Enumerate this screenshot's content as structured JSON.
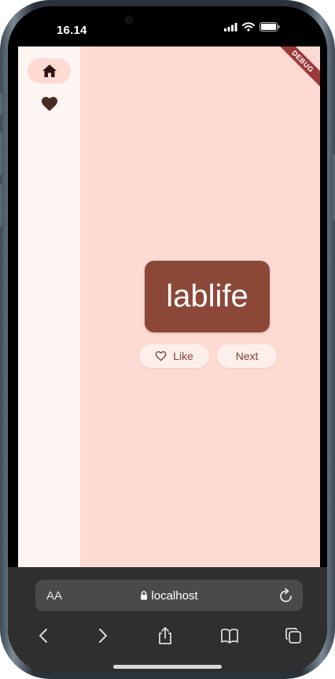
{
  "status_bar": {
    "time": "16.14"
  },
  "app": {
    "debug_label": "DEBUG",
    "rail": {
      "items": [
        {
          "name": "home",
          "icon": "home-icon",
          "selected": true
        },
        {
          "name": "favorites",
          "icon": "heart-icon",
          "selected": false
        }
      ]
    },
    "word": "lablife",
    "like_label": "Like",
    "next_label": "Next"
  },
  "browser": {
    "aa_label": "AA",
    "url": "localhost",
    "toolbar": [
      "back-icon",
      "forward-icon",
      "share-icon",
      "bookmarks-icon",
      "tabs-icon"
    ]
  },
  "colors": {
    "background": "#fddbd2",
    "rail": "#fcf5f2",
    "card": "#8b4838",
    "button": "#fcefec",
    "button_text": "#7a4536"
  }
}
